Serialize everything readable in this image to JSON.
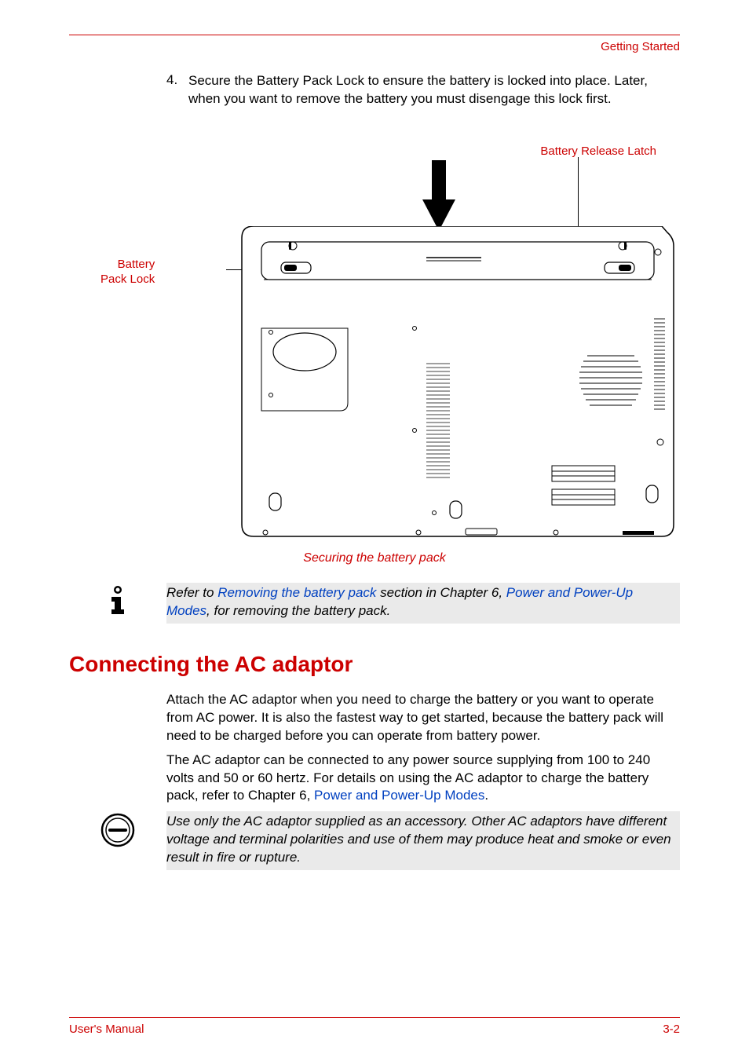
{
  "header": {
    "section_title": "Getting Started"
  },
  "step4": {
    "number": "4.",
    "text": "Secure the Battery Pack Lock to ensure the battery is locked into place. Later, when you want to remove the battery you must disengage this lock first."
  },
  "figure": {
    "callout_right": "Battery Release Latch",
    "callout_left_line1": "Battery",
    "callout_left_line2": "Pack Lock",
    "caption": "Securing the battery pack"
  },
  "note1": {
    "prefix": "Refer to ",
    "link1": "Removing the battery pack",
    "middle": " section in Chapter 6, ",
    "link2": "Power and Power-Up Modes",
    "suffix": ", for removing the battery pack."
  },
  "heading": "Connecting the AC adaptor",
  "para1": "Attach the AC adaptor when you need to charge the battery or you want to operate from AC power. It is also the fastest way to get started, because the battery pack will need to be charged before you can operate from battery power.",
  "para2_prefix": "The AC adaptor can be connected to any power source supplying from 100 to 240 volts and 50 or 60 hertz. For details on using the AC adaptor to charge the battery pack, refer to Chapter 6, ",
  "para2_link": "Power and Power-Up Modes",
  "para2_suffix": ".",
  "caution": "Use only the AC adaptor supplied as an accessory. Other AC adaptors have different voltage and terminal polarities and use of them may produce heat and smoke or even result in fire or rupture.",
  "footer": {
    "left": "User's Manual",
    "right": "3-2"
  }
}
